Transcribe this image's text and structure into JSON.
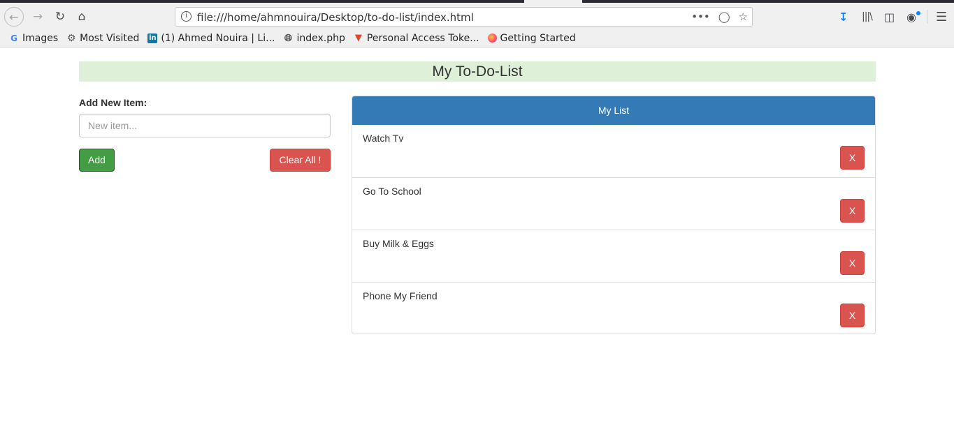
{
  "browser": {
    "url": "file:///home/ahmnouira/Desktop/to-do-list/index.html",
    "bookmarks": [
      {
        "label": "Images",
        "icon": "google-icon"
      },
      {
        "label": "Most Visited",
        "icon": "gear-icon"
      },
      {
        "label": "(1) Ahmed Nouira | Li...",
        "icon": "linkedin-icon"
      },
      {
        "label": "index.php",
        "icon": "globe-icon"
      },
      {
        "label": "Personal Access Toke...",
        "icon": "gitlab-icon"
      },
      {
        "label": "Getting Started",
        "icon": "firefox-icon"
      }
    ]
  },
  "app": {
    "title": "My To-Do-List",
    "form": {
      "label": "Add New Item:",
      "placeholder": "New item...",
      "add_label": "Add",
      "clear_label": "Clear All !"
    },
    "list": {
      "heading": "My List",
      "items": [
        {
          "text": "Watch Tv",
          "delete_label": "X"
        },
        {
          "text": "Go To School",
          "delete_label": "X"
        },
        {
          "text": "Buy Milk & Eggs",
          "delete_label": "X"
        },
        {
          "text": "Phone My Friend",
          "delete_label": "X"
        }
      ]
    }
  },
  "colors": {
    "title_bg": "#dff0d8",
    "panel_heading": "#337ab7",
    "success": "#449d44",
    "danger": "#d9534f"
  }
}
